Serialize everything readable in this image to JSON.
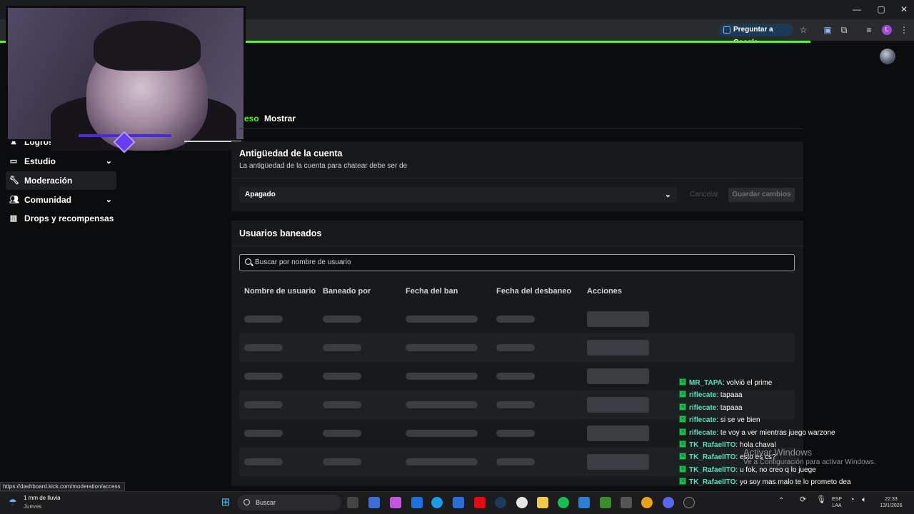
{
  "browser": {
    "google_button": "Preguntar a Google",
    "profile_initial": "L"
  },
  "sidebar": {
    "items": [
      {
        "label": "Logros",
        "icon": "trophy-icon"
      },
      {
        "label": "Estudio",
        "icon": "studio-icon"
      },
      {
        "label": "Moderación",
        "icon": "wrench-icon"
      },
      {
        "label": "Comunidad",
        "icon": "community-icon"
      },
      {
        "label": "Drops y recompensas",
        "icon": "gift-icon"
      }
    ]
  },
  "tabs": [
    "eso",
    "Mostrar"
  ],
  "account_age": {
    "title": "Antigüedad de la cuenta",
    "subtitle": "La antigüedad de la cuenta para chatear debe ser de",
    "selected": "Apagado",
    "cancel_label": "Cancelar",
    "save_label": "Guardar cambios"
  },
  "banned": {
    "title": "Usuarios baneados",
    "search_placeholder": "Buscar por nombre de usuario",
    "columns": [
      "Nombre de usuario",
      "Baneado por",
      "Fecha del ban",
      "Fecha del desbaneo",
      "Acciones"
    ]
  },
  "status_url": "https://dashboard.kick.com/moderation/access",
  "chat": [
    {
      "user": "MR_TAPA",
      "text": "volvió el prime"
    },
    {
      "user": "riflecate",
      "text": "tapaaa"
    },
    {
      "user": "riflecate",
      "text": "tapaaa"
    },
    {
      "user": "riflecate",
      "text": "si se ve bien"
    },
    {
      "user": "riflecate",
      "text": "te voy a ver mientras juego warzone"
    },
    {
      "user": "TK_RafaelITO",
      "text": "hola chaval"
    },
    {
      "user": "TK_RafaelITO",
      "text": "esto es cs?"
    },
    {
      "user": "TK_RafaelITO",
      "text": "u fok, no creo q lo juege"
    },
    {
      "user": "TK_RafaelITO",
      "text": "yo soy mas malo te lo prometo dea"
    }
  ],
  "windows_watermark": {
    "title": "Activar Windows",
    "subtitle": "Ve a Configuración para activar Windows."
  },
  "taskbar": {
    "weather_line1": "1 mm de lluvia",
    "weather_line2": "Jueves",
    "search": "Buscar",
    "lang1": "ESP",
    "lang2": "LAA",
    "time": "22:33",
    "date": "13/1/2026"
  }
}
